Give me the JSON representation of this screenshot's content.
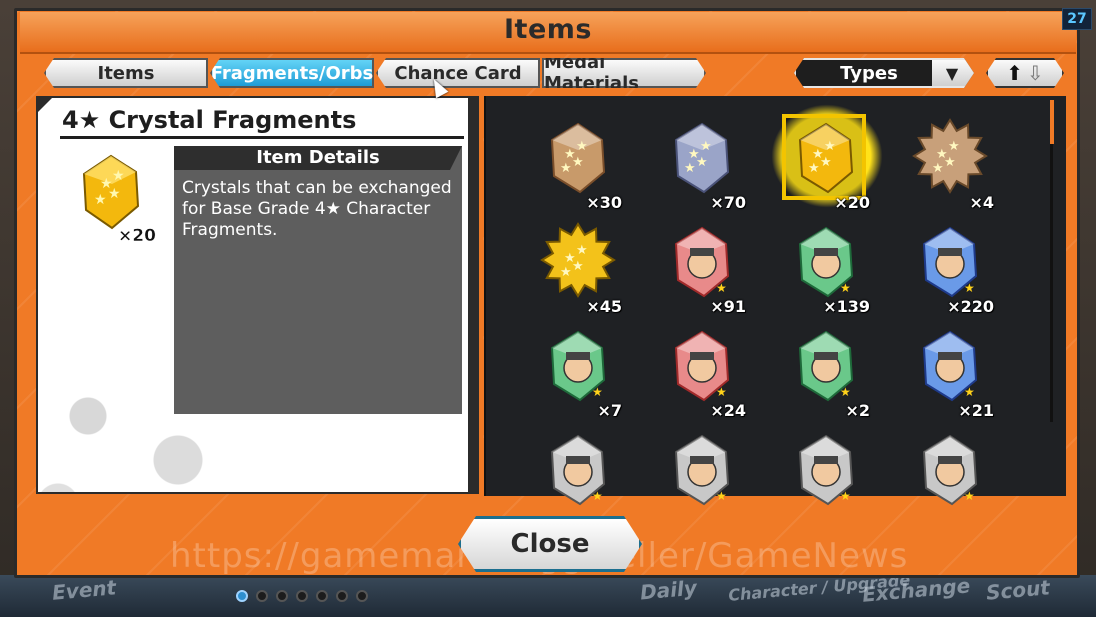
{
  "window": {
    "title": "Items",
    "counter": "27"
  },
  "tabs": [
    {
      "label": "Items",
      "active": false
    },
    {
      "label": "Fragments/Orbs",
      "active": true
    },
    {
      "label": "Chance Card",
      "active": false
    },
    {
      "label": "Medal Materials",
      "active": false
    }
  ],
  "filter": {
    "types_label": "Types"
  },
  "selected_item": {
    "name": "4★ Crystal Fragments",
    "count": "×20",
    "details_heading": "Item Details",
    "description": "Crystals that can be exchanged for Base Grade 4★ Character Fragments."
  },
  "grid": {
    "items": [
      {
        "icon": "bronze-crystal-icon",
        "count": "×30"
      },
      {
        "icon": "silver-crystal-icon",
        "count": "×70"
      },
      {
        "icon": "gold-crystal-icon",
        "count": "×20",
        "selected": true
      },
      {
        "icon": "bronze-spiky-orb-icon",
        "count": "×4"
      },
      {
        "icon": "gold-spiky-orb-icon",
        "count": "×45"
      },
      {
        "icon": "luffy-fragment-icon",
        "count": "×91"
      },
      {
        "icon": "zoro-fragment-icon",
        "count": "×139"
      },
      {
        "icon": "usopp-fragment-icon",
        "count": "×220"
      },
      {
        "icon": "nami-fragment-icon",
        "count": "×7"
      },
      {
        "icon": "chopper-fragment-icon",
        "count": "×24"
      },
      {
        "icon": "robin-fragment-icon",
        "count": "×2"
      },
      {
        "icon": "brook-fragment-icon",
        "count": "×21"
      },
      {
        "icon": "character-fragment-icon",
        "count": ""
      },
      {
        "icon": "character-fragment-icon",
        "count": ""
      },
      {
        "icon": "character-fragment-icon",
        "count": ""
      },
      {
        "icon": "character-fragment-icon",
        "count": ""
      }
    ]
  },
  "footer": {
    "close_label": "Close",
    "watermark": "https://gamemarket.gg/seller/GameNews"
  },
  "nav": [
    "Event",
    "Daily",
    "Character / Upgrade",
    "Exchange",
    "Scout"
  ],
  "colors": {
    "accent": "#f07a26",
    "active_tab": "#1f9cd6",
    "gold": "#f3c400"
  }
}
